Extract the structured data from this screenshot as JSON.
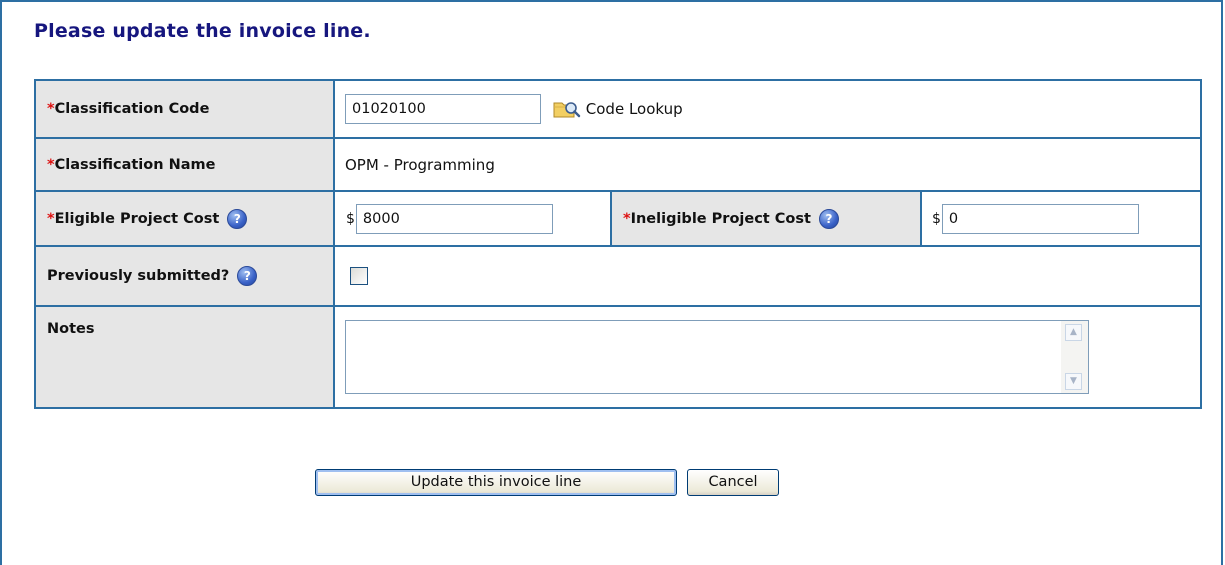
{
  "heading": "Please update the invoice line.",
  "required_marker": "*",
  "fields": {
    "classification_code": {
      "label": "Classification Code",
      "value": "01020100"
    },
    "code_lookup": {
      "label": "Code Lookup",
      "icon": "folder-search-icon"
    },
    "classification_name": {
      "label": "Classification Name",
      "value": "OPM - Programming"
    },
    "eligible_cost": {
      "label": "Eligible Project Cost",
      "currency": "$",
      "value": "8000",
      "help_icon": "help-icon"
    },
    "ineligible_cost": {
      "label": "Ineligible Project Cost",
      "currency": "$",
      "value": "0",
      "help_icon": "help-icon"
    },
    "previously_submitted": {
      "label": "Previously submitted?",
      "checked": false,
      "help_icon": "help-icon"
    },
    "notes": {
      "label": "Notes",
      "value": ""
    }
  },
  "buttons": {
    "update": "Update this invoice line",
    "cancel": "Cancel"
  },
  "colors": {
    "border": "#2d6fa3",
    "heading": "#16167e",
    "required": "#dd1111",
    "label_bg": "#e6e6e6"
  }
}
